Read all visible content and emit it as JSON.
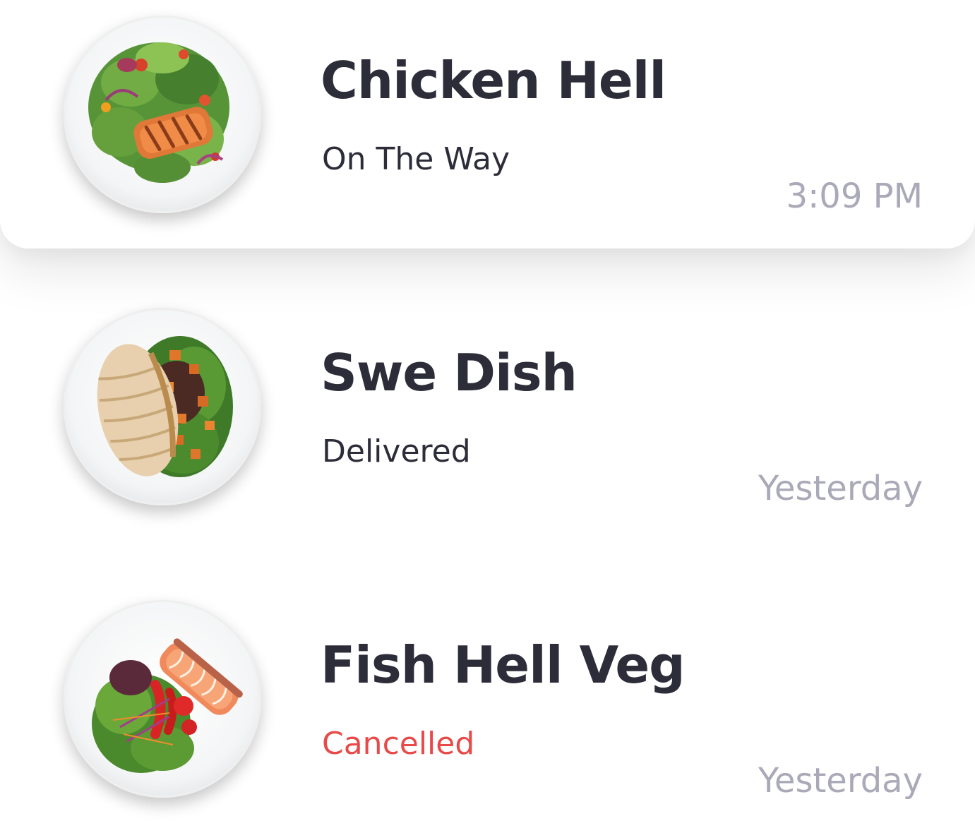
{
  "orders": [
    {
      "name": "Chicken Hell",
      "status": "On The Way",
      "time": "3:09 PM",
      "image_icon": "salad-with-grilled-salmon-plate"
    },
    {
      "name": "Swe Dish",
      "status": "Delivered",
      "time": "Yesterday",
      "image_icon": "salad-with-sliced-chicken-plate"
    },
    {
      "name": "Fish Hell Veg",
      "status": "Cancelled",
      "time": "Yesterday",
      "image_icon": "salad-with-salmon-fillet-plate"
    }
  ],
  "colors": {
    "title": "#2d2d3a",
    "status_default": "#2d2d3a",
    "status_cancelled": "#e84a4a",
    "time": "#a9a9b8"
  }
}
